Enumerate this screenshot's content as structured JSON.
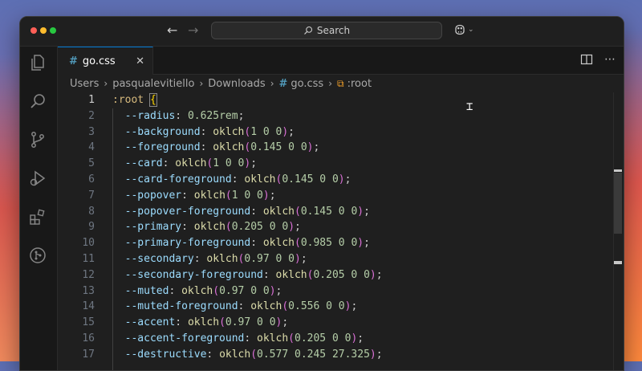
{
  "titlebar": {
    "search_placeholder": "Search"
  },
  "tabs": [
    {
      "label": "go.css"
    }
  ],
  "breadcrumb": {
    "items": [
      "Users",
      "pasqualevitiello",
      "Downloads",
      "go.css",
      ":root"
    ]
  },
  "editor": {
    "lines": [
      {
        "n": "1",
        "selector": ":root",
        "open": "{"
      },
      {
        "n": "2",
        "prop": "--radius",
        "num": "0.625",
        "unit": "rem"
      },
      {
        "n": "3",
        "prop": "--background",
        "args": "1 0 0"
      },
      {
        "n": "4",
        "prop": "--foreground",
        "args": "0.145 0 0"
      },
      {
        "n": "5",
        "prop": "--card",
        "args": "1 0 0"
      },
      {
        "n": "6",
        "prop": "--card-foreground",
        "args": "0.145 0 0"
      },
      {
        "n": "7",
        "prop": "--popover",
        "args": "1 0 0"
      },
      {
        "n": "8",
        "prop": "--popover-foreground",
        "args": "0.145 0 0"
      },
      {
        "n": "9",
        "prop": "--primary",
        "args": "0.205 0 0"
      },
      {
        "n": "10",
        "prop": "--primary-foreground",
        "args": "0.985 0 0"
      },
      {
        "n": "11",
        "prop": "--secondary",
        "args": "0.97 0 0"
      },
      {
        "n": "12",
        "prop": "--secondary-foreground",
        "args": "0.205 0 0"
      },
      {
        "n": "13",
        "prop": "--muted",
        "args": "0.97 0 0"
      },
      {
        "n": "14",
        "prop": "--muted-foreground",
        "args": "0.556 0 0"
      },
      {
        "n": "15",
        "prop": "--accent",
        "args": "0.97 0 0"
      },
      {
        "n": "16",
        "prop": "--accent-foreground",
        "args": "0.205 0 0"
      },
      {
        "n": "17",
        "prop": "--destructive",
        "args": "0.577 0.245 27.325"
      }
    ],
    "fn_name": "oklch"
  },
  "activity_icons": [
    "explorer-icon",
    "search-icon",
    "source-control-icon",
    "run-debug-icon",
    "extensions-icon",
    "git-icon"
  ],
  "colors": {
    "accent": "#0078d4",
    "property": "#9cdcfe",
    "function": "#dcdcaa",
    "number": "#b5cea8",
    "selector": "#d7ba7d",
    "paren": "#da70d6"
  }
}
